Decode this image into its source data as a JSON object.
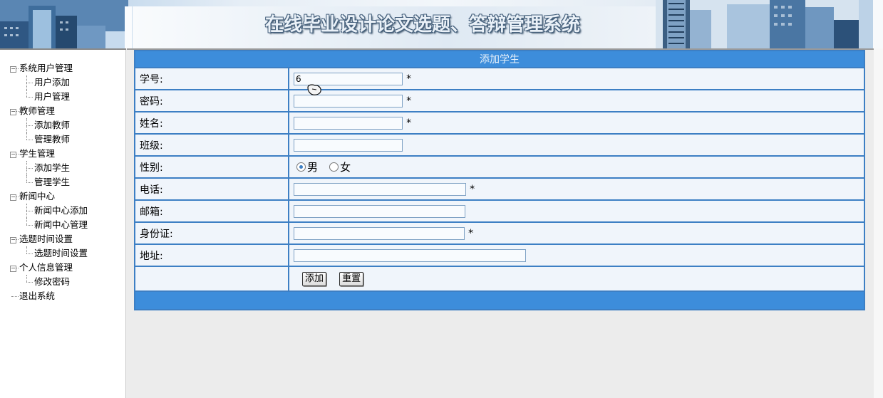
{
  "header": {
    "title": "在线毕业设计论文选题、答辩管理系统"
  },
  "sidebar": {
    "groups": [
      {
        "label": "系统用户管理",
        "items": [
          "用户添加",
          "用户管理"
        ]
      },
      {
        "label": "教师管理",
        "items": [
          "添加教师",
          "管理教师"
        ]
      },
      {
        "label": "学生管理",
        "items": [
          "添加学生",
          "管理学生"
        ]
      },
      {
        "label": "新闻中心",
        "items": [
          "新闻中心添加",
          "新闻中心管理"
        ]
      },
      {
        "label": "选题时间设置",
        "items": [
          "选题时间设置"
        ]
      },
      {
        "label": "个人信息管理",
        "items": [
          "修改密码"
        ]
      }
    ],
    "logout": "退出系统",
    "expand_glyph": "−"
  },
  "form": {
    "title": "添加学生",
    "fields": {
      "student_id": {
        "label": "学号:",
        "value": "6",
        "required": "*"
      },
      "password": {
        "label": "密码:",
        "value": "",
        "required": "*"
      },
      "name": {
        "label": "姓名:",
        "value": "",
        "required": "*"
      },
      "class": {
        "label": "班级:",
        "value": ""
      },
      "gender": {
        "label": "性别:",
        "options": [
          "男",
          "女"
        ],
        "selected": "男"
      },
      "phone": {
        "label": "电话:",
        "value": "",
        "required": "*"
      },
      "email": {
        "label": "邮箱:",
        "value": ""
      },
      "id_card": {
        "label": "身份证:",
        "value": "",
        "required": "*"
      },
      "address": {
        "label": "地址:",
        "value": ""
      }
    },
    "buttons": {
      "add": "添加",
      "reset": "重置"
    }
  },
  "colors": {
    "accent": "#3d8ddb",
    "border": "#3d7fc4",
    "row_bg": "#f0f5fb"
  }
}
